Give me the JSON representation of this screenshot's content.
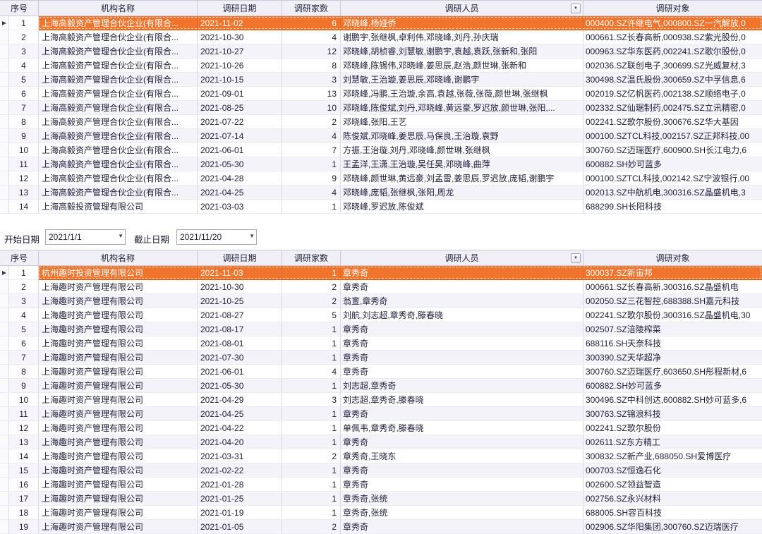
{
  "colors": {
    "selection_bg": "#F1742D",
    "selection_text": "#FFFFFF",
    "header_bg": "#F0EFF5",
    "row_alt_bg": "#F5F3FA",
    "row_bg": "#FFFFFF",
    "grid_line": "#DCD9E6",
    "text": "#1D1D38"
  },
  "filter_bar": {
    "start_label": "开始日期",
    "start_value": "2021/1/1",
    "end_label": "截止日期",
    "end_value": "2021/11/20"
  },
  "table_top": {
    "columns": [
      "序号",
      "机构名称",
      "调研日期",
      "调研家数",
      "调研人员",
      "调研对象"
    ],
    "selected_index": 0,
    "rows": [
      [
        "1",
        "上海高毅资产管理合伙企业(有限合...",
        "2021-11-02",
        "6",
        "邓晓峰,杨娅侨",
        "000400.SZ许继电气,000800.SZ一汽解放,0"
      ],
      [
        "2",
        "上海高毅资产管理合伙企业(有限合...",
        "2021-10-30",
        "4",
        "谢鹏宇,张继枫,卓利伟,邓晓峰,刘丹,孙庆瑞",
        "000661.SZ长春高新,000938.SZ紫光股份,0"
      ],
      [
        "3",
        "上海高毅资产管理合伙企业(有限合...",
        "2021-10-27",
        "12",
        "邓晓峰,胡桢睿,刘慧敏,谢鹏宇,袁越,袁跃,张新和,张阳",
        "000963.SZ华东医药,002241.SZ歌尔股份,0"
      ],
      [
        "4",
        "上海高毅资产管理合伙企业(有限合...",
        "2021-10-26",
        "8",
        "邓晓峰,陈锡伟,邓晓峰,姜思辰,赵浩,颜世琳,张新和",
        "002036.SZ联创电子,300699.SZ光威复材,3"
      ],
      [
        "5",
        "上海高毅资产管理合伙企业(有限合...",
        "2021-10-15",
        "3",
        "刘慧敏,王治璇,姜思辰,邓晓峰,谢鹏宇",
        "300498.SZ温氏股份,300659.SZ中孚信息,6"
      ],
      [
        "6",
        "上海高毅资产管理合伙企业(有限合...",
        "2021-09-01",
        "13",
        "邓晓峰,冯鹏,王治璇,余高,袁越,张薇,张薇,颜世琳,张继枫",
        "002019.SZ亿帆医药,002138.SZ顺络电子,0"
      ],
      [
        "7",
        "上海高毅资产管理合伙企业(有限合...",
        "2021-08-25",
        "10",
        "邓晓峰,陈俊斌,刘丹,邓晓峰,黄远豪,罗迟放,颜世琳,张阳,...",
        "002332.SZ仙琚制药,002475.SZ立讯精密,0"
      ],
      [
        "8",
        "上海高毅资产管理合伙企业(有限合...",
        "2021-07-22",
        "2",
        "邓晓峰,张阳,王艺",
        "002241.SZ歌尔股份,300676.SZ华大基因"
      ],
      [
        "9",
        "上海高毅资产管理合伙企业(有限合...",
        "2021-07-14",
        "4",
        "陈俊斌,邓晓峰,姜思辰,马保良,王治璇,袁野",
        "000100.SZTCL科技,002157.SZ正邦科技,00"
      ],
      [
        "10",
        "上海高毅资产管理合伙企业(有限合...",
        "2021-06-01",
        "7",
        "方振,王治璇,刘丹,邓晓峰,颜世琳,张继枫",
        "300760.SZ迈瑞医疗,600900.SH长江电力,6"
      ],
      [
        "11",
        "上海高毅资产管理合伙企业(有限合...",
        "2021-05-30",
        "1",
        "王孟洋,王潇,王治璇,吴任昊,邓晓峰,曲萍",
        "600882.SH妙可蓝多"
      ],
      [
        "12",
        "上海高毅资产管理合伙企业(有限合...",
        "2021-04-28",
        "9",
        "邓晓峰,颜世琳,黄远豪,刘孟雷,姜思辰,罗迟放,庞韬,谢鹏宇",
        "000100.SZTCL科技,002142.SZ宁波银行,00"
      ],
      [
        "13",
        "上海高毅资产管理合伙企业(有限合...",
        "2021-04-25",
        "4",
        "邓晓峰,庞韬,张继枫,张阳,周龙",
        "002013.SZ中航机电,300316.SZ晶盛机电,3"
      ],
      [
        "14",
        "上海高毅投资管理有限公司",
        "2021-03-03",
        "1",
        "邓晓峰,罗迟放,陈俊斌",
        "688299.SH长阳科技"
      ]
    ]
  },
  "table_bottom": {
    "columns": [
      "序号",
      "机构名称",
      "调研日期",
      "调研家数",
      "调研人员",
      "调研对象"
    ],
    "selected_index": 0,
    "rows": [
      [
        "1",
        "杭州趣时投资管理有限公司",
        "2021-11-03",
        "1",
        "章秀奇",
        "300037.SZ新宙邦"
      ],
      [
        "2",
        "上海趣时资产管理有限公司",
        "2021-10-30",
        "2",
        "章秀奇",
        "000661.SZ长春高新,300316.SZ晶盛机电"
      ],
      [
        "3",
        "上海趣时资产管理有限公司",
        "2021-10-25",
        "2",
        "翁亶,章秀奇",
        "002050.SZ三花智控,688388.SH嘉元科技"
      ],
      [
        "4",
        "上海趣时资产管理有限公司",
        "2021-08-27",
        "5",
        "刘航,刘志超,章秀奇,滕春晓",
        "002241.SZ歌尔股份,300316.SZ晶盛机电,30"
      ],
      [
        "5",
        "上海趣时资产管理有限公司",
        "2021-08-17",
        "1",
        "章秀奇",
        "002507.SZ涪陵榨菜"
      ],
      [
        "6",
        "上海趣时资产管理有限公司",
        "2021-08-01",
        "1",
        "章秀奇",
        "688116.SH天奈科技"
      ],
      [
        "7",
        "上海趣时资产管理有限公司",
        "2021-07-30",
        "1",
        "章秀奇",
        "300390.SZ天华超净"
      ],
      [
        "8",
        "上海趣时资产管理有限公司",
        "2021-06-01",
        "4",
        "章秀奇",
        "300760.SZ迈瑞医疗,603650.SH彤程新材,6"
      ],
      [
        "9",
        "上海趣时资产管理有限公司",
        "2021-05-30",
        "1",
        "刘志超,章秀奇",
        "600882.SH妙可蓝多"
      ],
      [
        "10",
        "上海趣时资产管理有限公司",
        "2021-04-29",
        "3",
        "刘志超,章秀奇,滕春晓",
        "300496.SZ中科创达,600882.SH妙可蓝多,6"
      ],
      [
        "11",
        "上海趣时资产管理有限公司",
        "2021-04-25",
        "1",
        "章秀奇",
        "300763.SZ锦浪科技"
      ],
      [
        "12",
        "上海趣时资产管理有限公司",
        "2021-04-22",
        "1",
        "单佩韦,章秀奇,滕春晓",
        "002241.SZ歌尔股份"
      ],
      [
        "13",
        "上海趣时资产管理有限公司",
        "2021-04-20",
        "1",
        "章秀奇",
        "002611.SZ东方精工"
      ],
      [
        "14",
        "上海趣时资产管理有限公司",
        "2021-03-31",
        "2",
        "章秀奇,王晓东",
        "300832.SZ新产业,688050.SH爱博医疗"
      ],
      [
        "15",
        "上海趣时资产管理有限公司",
        "2021-02-22",
        "1",
        "章秀奇",
        "000703.SZ恒逸石化"
      ],
      [
        "16",
        "上海趣时资产管理有限公司",
        "2021-01-28",
        "1",
        "章秀奇",
        "002600.SZ领益智造"
      ],
      [
        "17",
        "上海趣时资产管理有限公司",
        "2021-01-25",
        "1",
        "章秀奇,张统",
        "002756.SZ永兴材料"
      ],
      [
        "18",
        "上海趣时资产管理有限公司",
        "2021-01-19",
        "1",
        "章秀奇,张统",
        "688005.SH容百科技"
      ],
      [
        "19",
        "上海趣时资产管理有限公司",
        "2021-01-05",
        "2",
        "章秀奇",
        "002906.SZ华阳集团,300760.SZ迈瑞医疗"
      ]
    ]
  }
}
